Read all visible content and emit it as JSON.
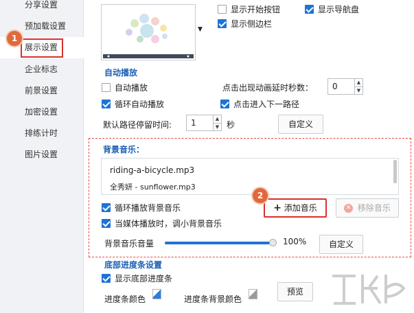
{
  "sidebar": {
    "items": [
      {
        "label": "分享设置"
      },
      {
        "label": "预加载设置"
      },
      {
        "label": "展示设置"
      },
      {
        "label": "企业标志"
      },
      {
        "label": "前景设置"
      },
      {
        "label": "加密设置"
      },
      {
        "label": "排练计时"
      },
      {
        "label": "图片设置"
      }
    ],
    "active_index": 2
  },
  "badges": {
    "one": "1",
    "two": "2"
  },
  "top_options": {
    "show_start_button": {
      "label": "显示开始按钮",
      "checked": false
    },
    "show_nav_disk": {
      "label": "显示导航盘",
      "checked": true
    },
    "show_sidebar": {
      "label": "显示侧边栏",
      "checked": true
    }
  },
  "autoplay": {
    "title": "自动播放",
    "autoplay": {
      "label": "自动播放",
      "checked": false
    },
    "loop_autoplay": {
      "label": "循环自动播放",
      "checked": true
    },
    "delay_label": "点击出现动画延时秒数：",
    "delay_value": "0",
    "click_next": {
      "label": "点击进入下一路径",
      "checked": true
    },
    "stay_label": "默认路径停留时间:",
    "stay_value": "1",
    "stay_unit": "秒",
    "custom_button": "自定义"
  },
  "music": {
    "title": "背景音乐：",
    "tracks": [
      "riding-a-bicycle.mp3",
      "全秀妍 - sunflower.mp3"
    ],
    "loop": {
      "label": "循环播放背景音乐",
      "checked": true
    },
    "lower_on_media": {
      "label": "当媒体播放时，调小背景音乐",
      "checked": true
    },
    "add_button": "添加音乐",
    "remove_button": "移除音乐",
    "volume_label": "背景音乐音量",
    "volume_percent": 100,
    "volume_text": "100%",
    "custom_button": "自定义"
  },
  "progress": {
    "title": "底部进度条设置",
    "show_bottom": {
      "label": "显示底部进度条",
      "checked": true
    },
    "bar_color_label": "进度条颜色",
    "bar_color": "#2a7de1",
    "bg_color_label": "进度条背景颜色",
    "bg_color": "#9a9a9a",
    "preview_button": "预览"
  },
  "colors": {
    "accent": "#1e73d6",
    "highlight": "#d9302c",
    "badge": "#e0693b"
  }
}
